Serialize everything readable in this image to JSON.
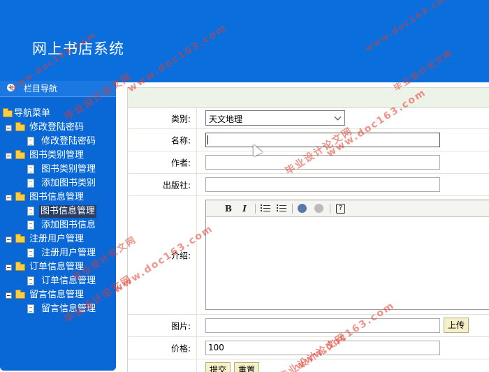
{
  "app": {
    "title": "网上书店系统"
  },
  "sidebar": {
    "header": "栏目导航",
    "tree": [
      {
        "label": "导航菜单",
        "kind": "root"
      },
      {
        "label": "修改登陆密码",
        "kind": "folder"
      },
      {
        "label": "修改登陆密码",
        "kind": "page"
      },
      {
        "label": "图书类别管理",
        "kind": "folder"
      },
      {
        "label": "图书类别管理",
        "kind": "page"
      },
      {
        "label": "添加图书类别",
        "kind": "page"
      },
      {
        "label": "图书信息管理",
        "kind": "folder"
      },
      {
        "label": "图书信息管理",
        "kind": "page",
        "selected": true
      },
      {
        "label": "添加图书信息",
        "kind": "page"
      },
      {
        "label": "注册用户管理",
        "kind": "folder"
      },
      {
        "label": "注册用户管理",
        "kind": "page"
      },
      {
        "label": "订单信息管理",
        "kind": "folder"
      },
      {
        "label": "订单信息管理",
        "kind": "page"
      },
      {
        "label": "留言信息管理",
        "kind": "folder"
      },
      {
        "label": "留言信息管理",
        "kind": "page"
      }
    ]
  },
  "form": {
    "category_label": "类别:",
    "category_value": "天文地理",
    "name_label": "名称:",
    "name_value": "",
    "author_label": "作者:",
    "author_value": "",
    "publisher_label": "出版社:",
    "publisher_value": "",
    "intro_label": "介绍:",
    "image_label": "图片:",
    "image_value": "",
    "upload_label": "上传",
    "price_label": "价格:",
    "price_value": "100",
    "submit_label": "提交",
    "reset_label": "重置"
  },
  "editor_toolbar": {
    "bold": "B",
    "italic": "I",
    "help": "?"
  },
  "watermarks": [
    "www.doc163.com",
    "毕业设计论文网",
    "www.doc163.com",
    "毕业设计论文网",
    "www.doc163.com",
    "毕业设计论文网",
    "www.doc163.com",
    "毕业设计论文网",
    "www.doc163.com",
    "毕业设计论文网",
    "www.doc163.com",
    "毕业设计论文网"
  ],
  "colors": {
    "header": "#0a6fdc",
    "sidebar": "#0a67d6",
    "watermark": "#e23b2e"
  }
}
